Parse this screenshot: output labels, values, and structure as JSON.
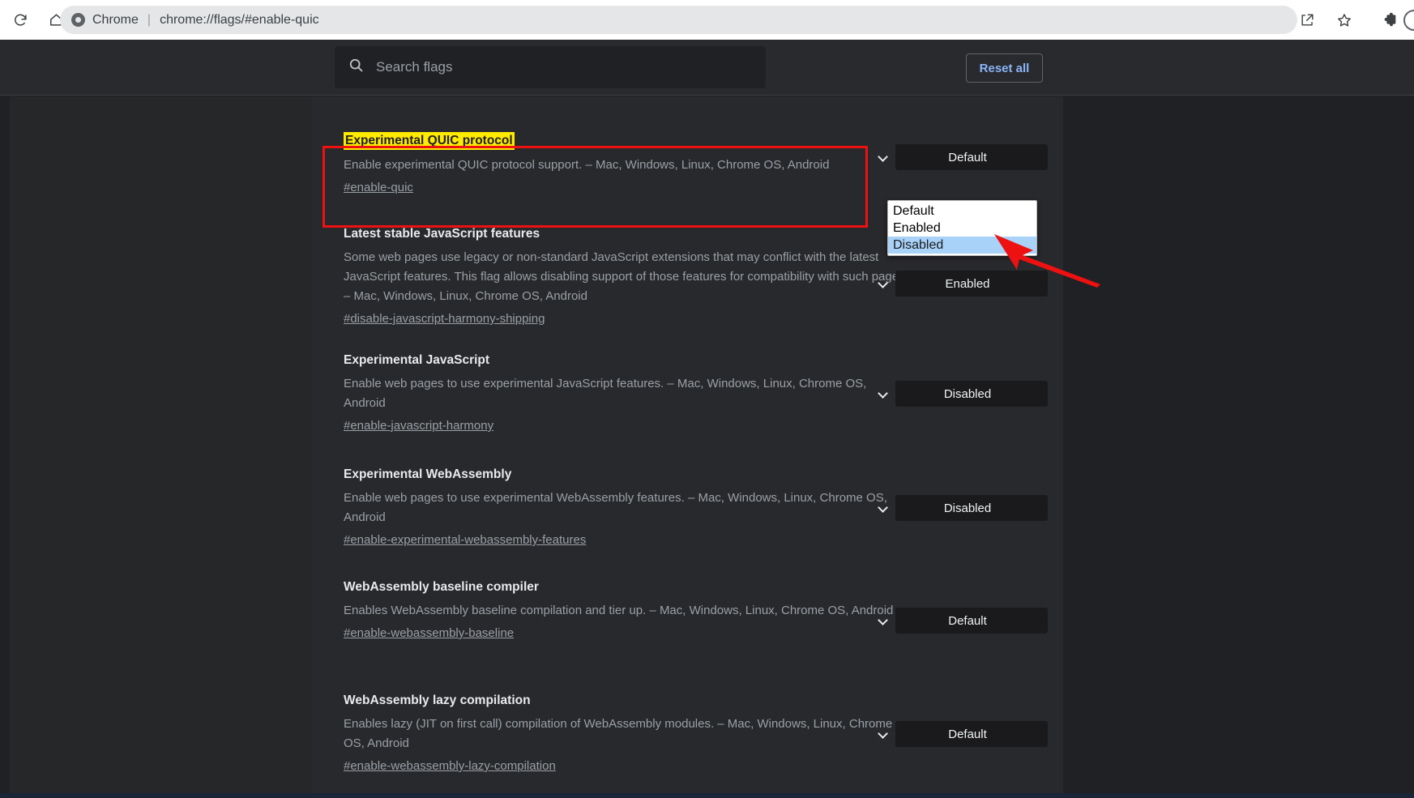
{
  "browser": {
    "reload_icon": "reload-icon",
    "home_icon": "home-icon",
    "omnibox": {
      "app_label": "Chrome",
      "separator": "|",
      "url": "chrome://flags/#enable-quic",
      "chrome_icon": "chrome-logo-icon"
    },
    "share_icon": "share-icon",
    "bookmark_icon": "bookmark-star-icon",
    "extensions_icon": "extensions-puzzle-icon",
    "profile_icon": "profile-avatar-icon"
  },
  "header": {
    "search": {
      "placeholder": "Search flags",
      "value": "",
      "icon": "search-icon"
    },
    "reset_label": "Reset all"
  },
  "dropdown_open": {
    "options": [
      "Default",
      "Enabled",
      "Disabled"
    ],
    "selected": "Disabled"
  },
  "colors": {
    "accent_blue": "#8ab4f8",
    "highlight_yellow": "#ffeb00",
    "annotation_red": "#ee1111",
    "dropdown_selection_blue": "#a8d2f8",
    "page_background": "#202124",
    "panel_background": "#28292c"
  },
  "flags": [
    {
      "title": "Experimental QUIC protocol",
      "description": "Enable experimental QUIC protocol support. – Mac, Windows, Linux, Chrome OS, Android",
      "link": "#enable-quic",
      "value": "Default",
      "highlighted": true
    },
    {
      "title": "Latest stable JavaScript features",
      "description": "Some web pages use legacy or non-standard JavaScript extensions that may conflict with the latest JavaScript features. This flag allows disabling support of those features for compatibility with such pages. – Mac, Windows, Linux, Chrome OS, Android",
      "link": "#disable-javascript-harmony-shipping",
      "value": "Enabled",
      "highlighted": false
    },
    {
      "title": "Experimental JavaScript",
      "description": "Enable web pages to use experimental JavaScript features. – Mac, Windows, Linux, Chrome OS, Android",
      "link": "#enable-javascript-harmony",
      "value": "Disabled",
      "highlighted": false
    },
    {
      "title": "Experimental WebAssembly",
      "description": "Enable web pages to use experimental WebAssembly features. – Mac, Windows, Linux, Chrome OS, Android",
      "link": "#enable-experimental-webassembly-features",
      "value": "Disabled",
      "highlighted": false
    },
    {
      "title": "WebAssembly baseline compiler",
      "description": "Enables WebAssembly baseline compilation and tier up. – Mac, Windows, Linux, Chrome OS, Android",
      "link": "#enable-webassembly-baseline",
      "value": "Default",
      "highlighted": false
    },
    {
      "title": "WebAssembly lazy compilation",
      "description": "Enables lazy (JIT on first call) compilation of WebAssembly modules. – Mac, Windows, Linux, Chrome OS, Android",
      "link": "#enable-webassembly-lazy-compilation",
      "value": "Default",
      "highlighted": false
    }
  ],
  "select_options": [
    "Default",
    "Enabled",
    "Disabled"
  ],
  "annotations": {
    "box_target": "Experimental QUIC protocol",
    "arrow_target": "Disabled"
  }
}
